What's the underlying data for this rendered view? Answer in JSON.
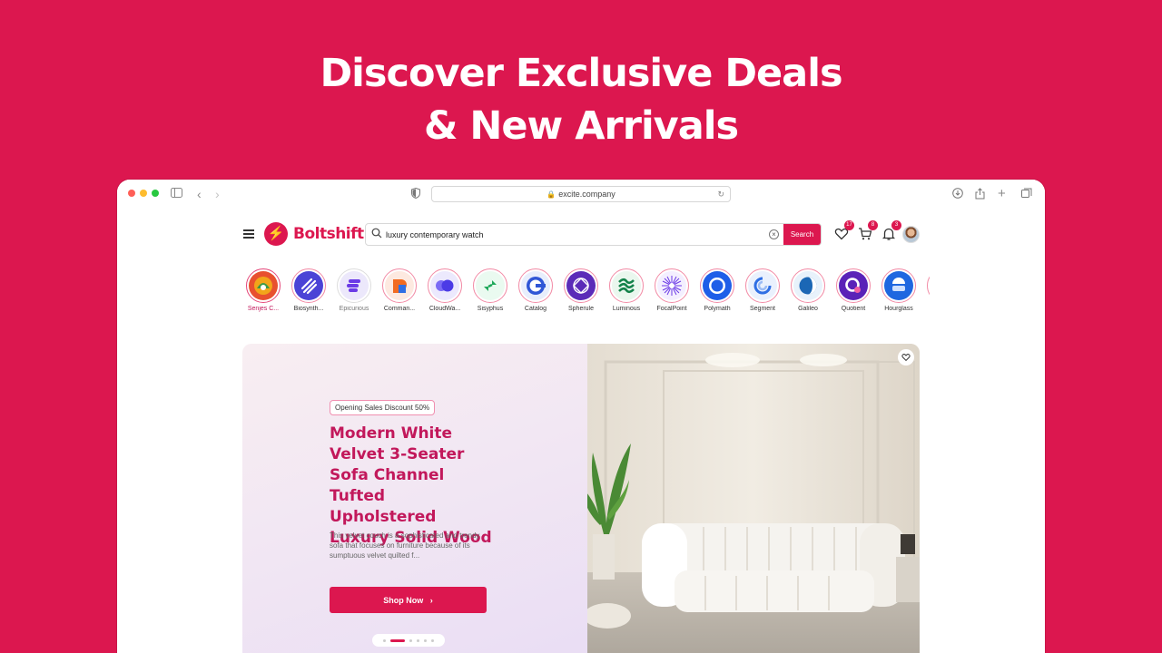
{
  "headline": {
    "line1": "Discover Exclusive Deals",
    "line2": "& New Arrivals"
  },
  "browser": {
    "url": "excite.company"
  },
  "header": {
    "logo_text": "Boltshift",
    "search": {
      "value": "luxury contemporary watch",
      "button_label": "Search"
    },
    "wishlist_count": "17",
    "cart_count": "8",
    "notification_count": "3"
  },
  "brands": [
    {
      "name": "Senjes C...",
      "icon": "senjes-logo"
    },
    {
      "name": "Biosynth...",
      "icon": "biosynthesis-logo"
    },
    {
      "name": "Epicurious",
      "icon": "epicurious-logo"
    },
    {
      "name": "Comman...",
      "icon": "command-logo"
    },
    {
      "name": "CloudWa...",
      "icon": "cloudwatch-logo"
    },
    {
      "name": "Sisyphus",
      "icon": "sisyphus-logo"
    },
    {
      "name": "Catalog",
      "icon": "catalog-logo"
    },
    {
      "name": "Spherule",
      "icon": "spherule-logo"
    },
    {
      "name": "Luminous",
      "icon": "luminous-logo"
    },
    {
      "name": "FocalPoint",
      "icon": "focalpoint-logo"
    },
    {
      "name": "Polymath",
      "icon": "polymath-logo"
    },
    {
      "name": "Segment",
      "icon": "segment-logo"
    },
    {
      "name": "Galileo",
      "icon": "galileo-logo"
    },
    {
      "name": "Quotient",
      "icon": "quotient-logo"
    },
    {
      "name": "Hourglass",
      "icon": "hourglass-logo"
    }
  ],
  "hero": {
    "badge": "Opening Sales Discount 50%",
    "title": "Modern White Velvet 3-Seater Sofa Channel Tufted Upholstered Luxury Solid Wood",
    "description": "This velvet couch is a sophisticated and trendy sofa that focuses on furniture because of its sumptuous velvet quilted f...",
    "button_label": "Shop Now",
    "slide_count": 6,
    "active_slide": 2
  },
  "colors": {
    "brand": "#dc174f",
    "title": "#c2185b"
  }
}
